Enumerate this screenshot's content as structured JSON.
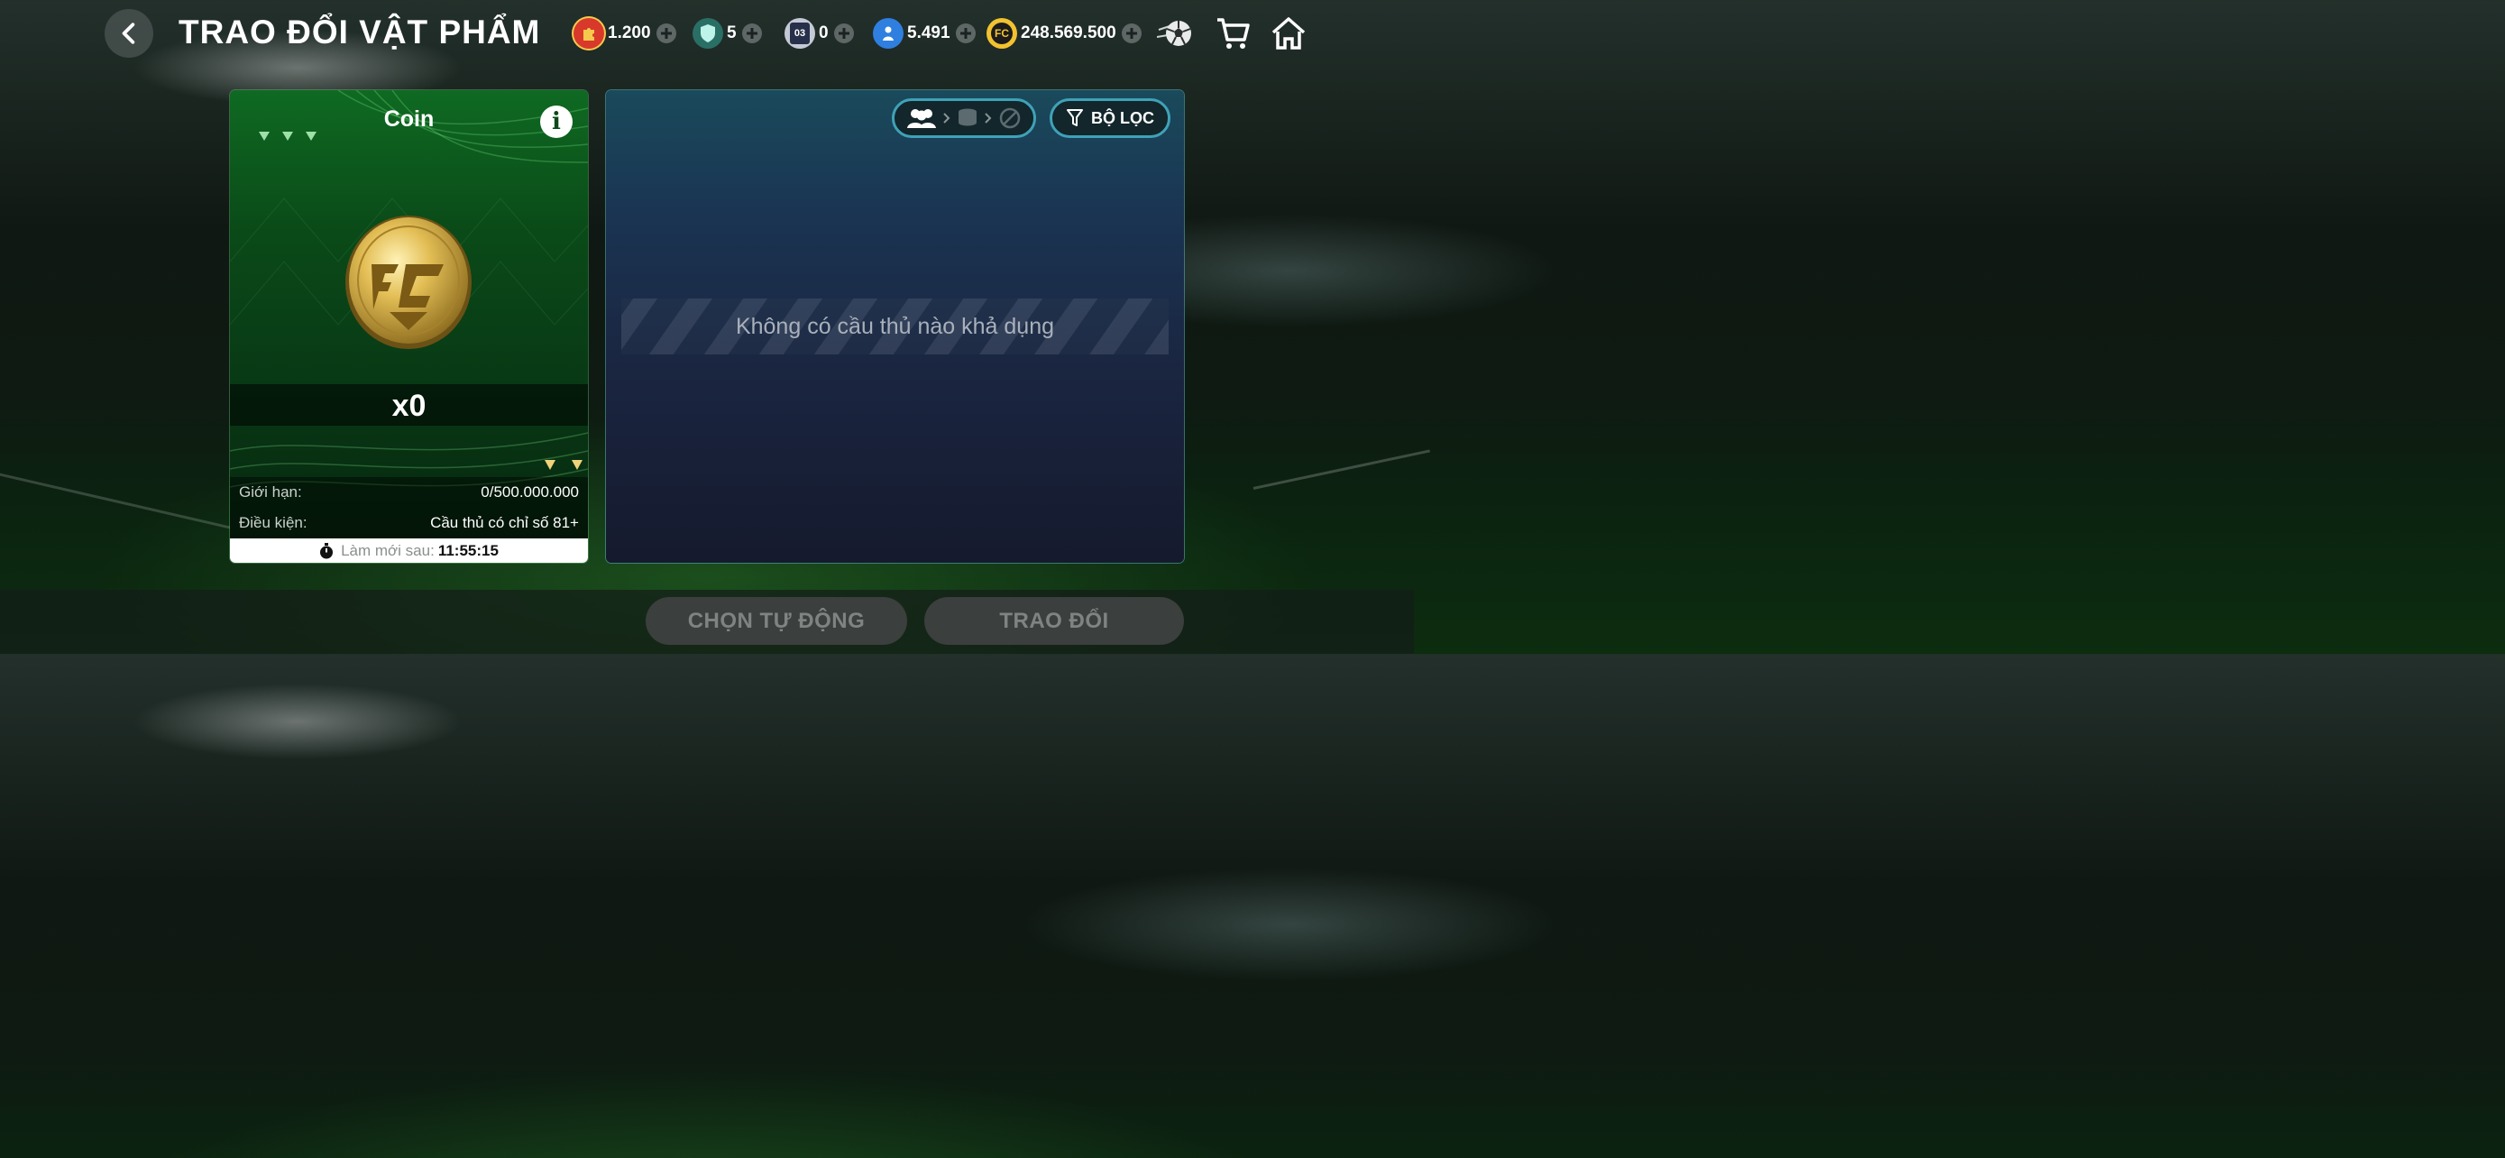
{
  "header": {
    "title": "TRAO ĐỔI VẬT PHẨM",
    "back_icon": "back-chevron-icon",
    "resources": [
      {
        "name": "event-token",
        "icon": "puzzle-token-icon",
        "value": "1.200",
        "color": "#d8392b"
      },
      {
        "name": "shield-token",
        "icon": "shield-icon",
        "value": "5",
        "color": "#79d9c9"
      },
      {
        "name": "card-03",
        "icon": "card-03-icon",
        "badge": "03",
        "value": "0",
        "color": "#c5c9d6"
      },
      {
        "name": "player-point",
        "icon": "player-icon",
        "value": "5.491",
        "color": "#2f7fe0"
      },
      {
        "name": "fc-coins",
        "icon": "fc-coin-icon",
        "value": "248.569.500",
        "color": "#f2c230"
      }
    ],
    "ball_icon": "soccer-ball-icon",
    "cart_icon": "cart-icon",
    "home_icon": "home-icon"
  },
  "card": {
    "title": "Coin",
    "info_icon": "info-icon",
    "quantity": "x0",
    "limit_label": "Giới hạn:",
    "limit_value": "0/500.000.000",
    "condition_label": "Điều kiện:",
    "condition_value": "Cầu thủ có chỉ số 81+",
    "refresh_label": "Làm mới sau:",
    "refresh_time": "11:55:15"
  },
  "panel": {
    "filter_label": "BỘ LỌC",
    "empty_text": "Không có cầu thủ nào khả dụng"
  },
  "actions": {
    "auto_select": "CHỌN TỰ ĐỘNG",
    "exchange": "TRAO ĐỔI"
  }
}
